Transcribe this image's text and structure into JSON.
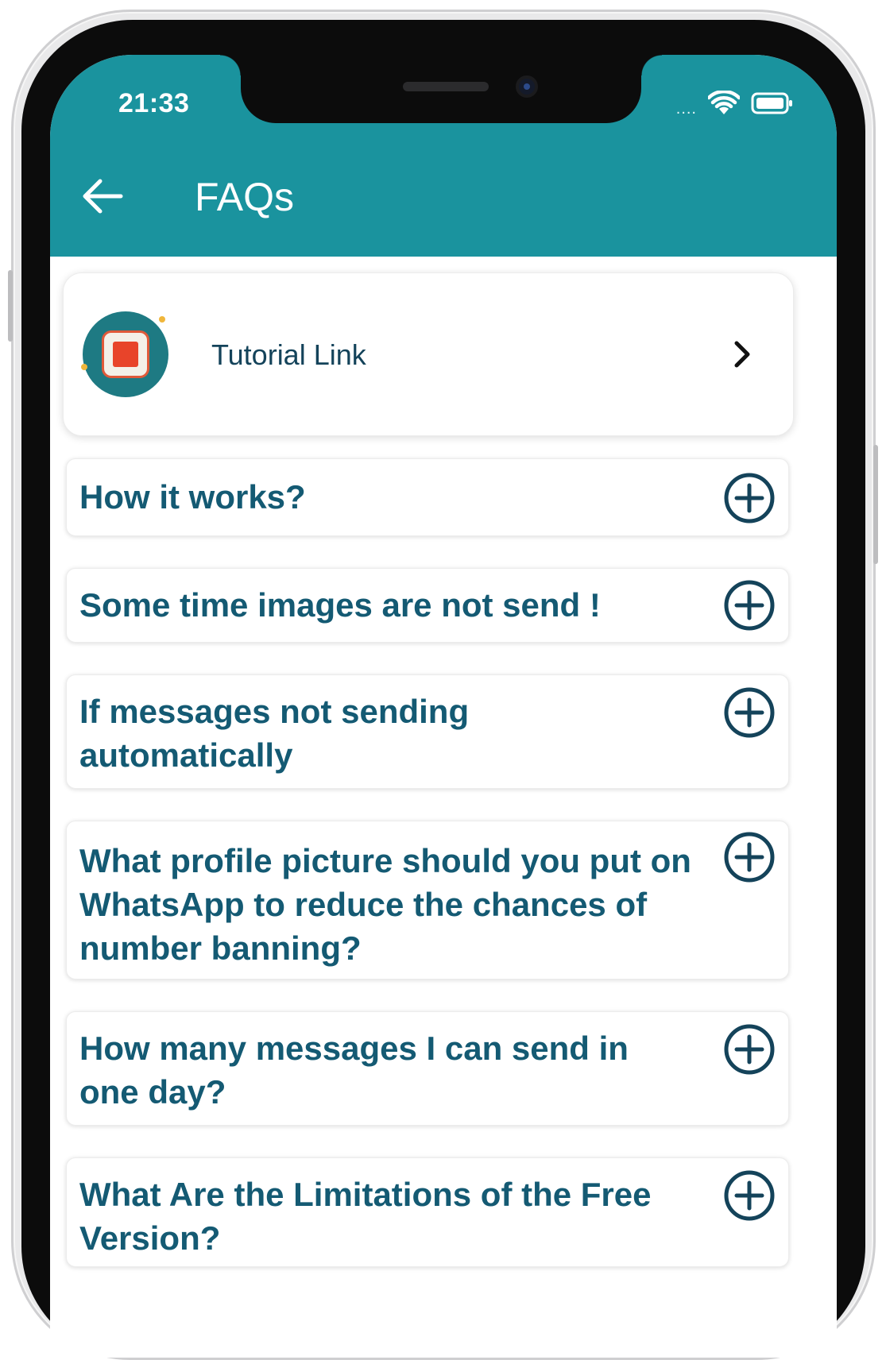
{
  "status_bar": {
    "time": "21:33",
    "signal": "....",
    "wifi_icon": "wifi-icon",
    "battery_icon": "battery-icon"
  },
  "header": {
    "title": "FAQs",
    "back_icon": "back-arrow-icon",
    "color": "#1a939e"
  },
  "tutorial": {
    "label": "Tutorial Link",
    "logo_icon": "tutorial-logo-icon",
    "chevron_icon": "chevron-right-icon"
  },
  "faqs": [
    {
      "question": "How it works?"
    },
    {
      "question": "Some time images are not send !"
    },
    {
      "question": "If messages not sending automatically"
    },
    {
      "question": "What profile picture  should you put on WhatsApp to reduce the chances of number banning?"
    },
    {
      "question": "How many messages I can send in one day?"
    },
    {
      "question": "What Are the Limitations of the Free Version?"
    }
  ],
  "colors": {
    "accent": "#1a939e",
    "question_text": "#145a73",
    "plus_icon": "#14435a"
  }
}
